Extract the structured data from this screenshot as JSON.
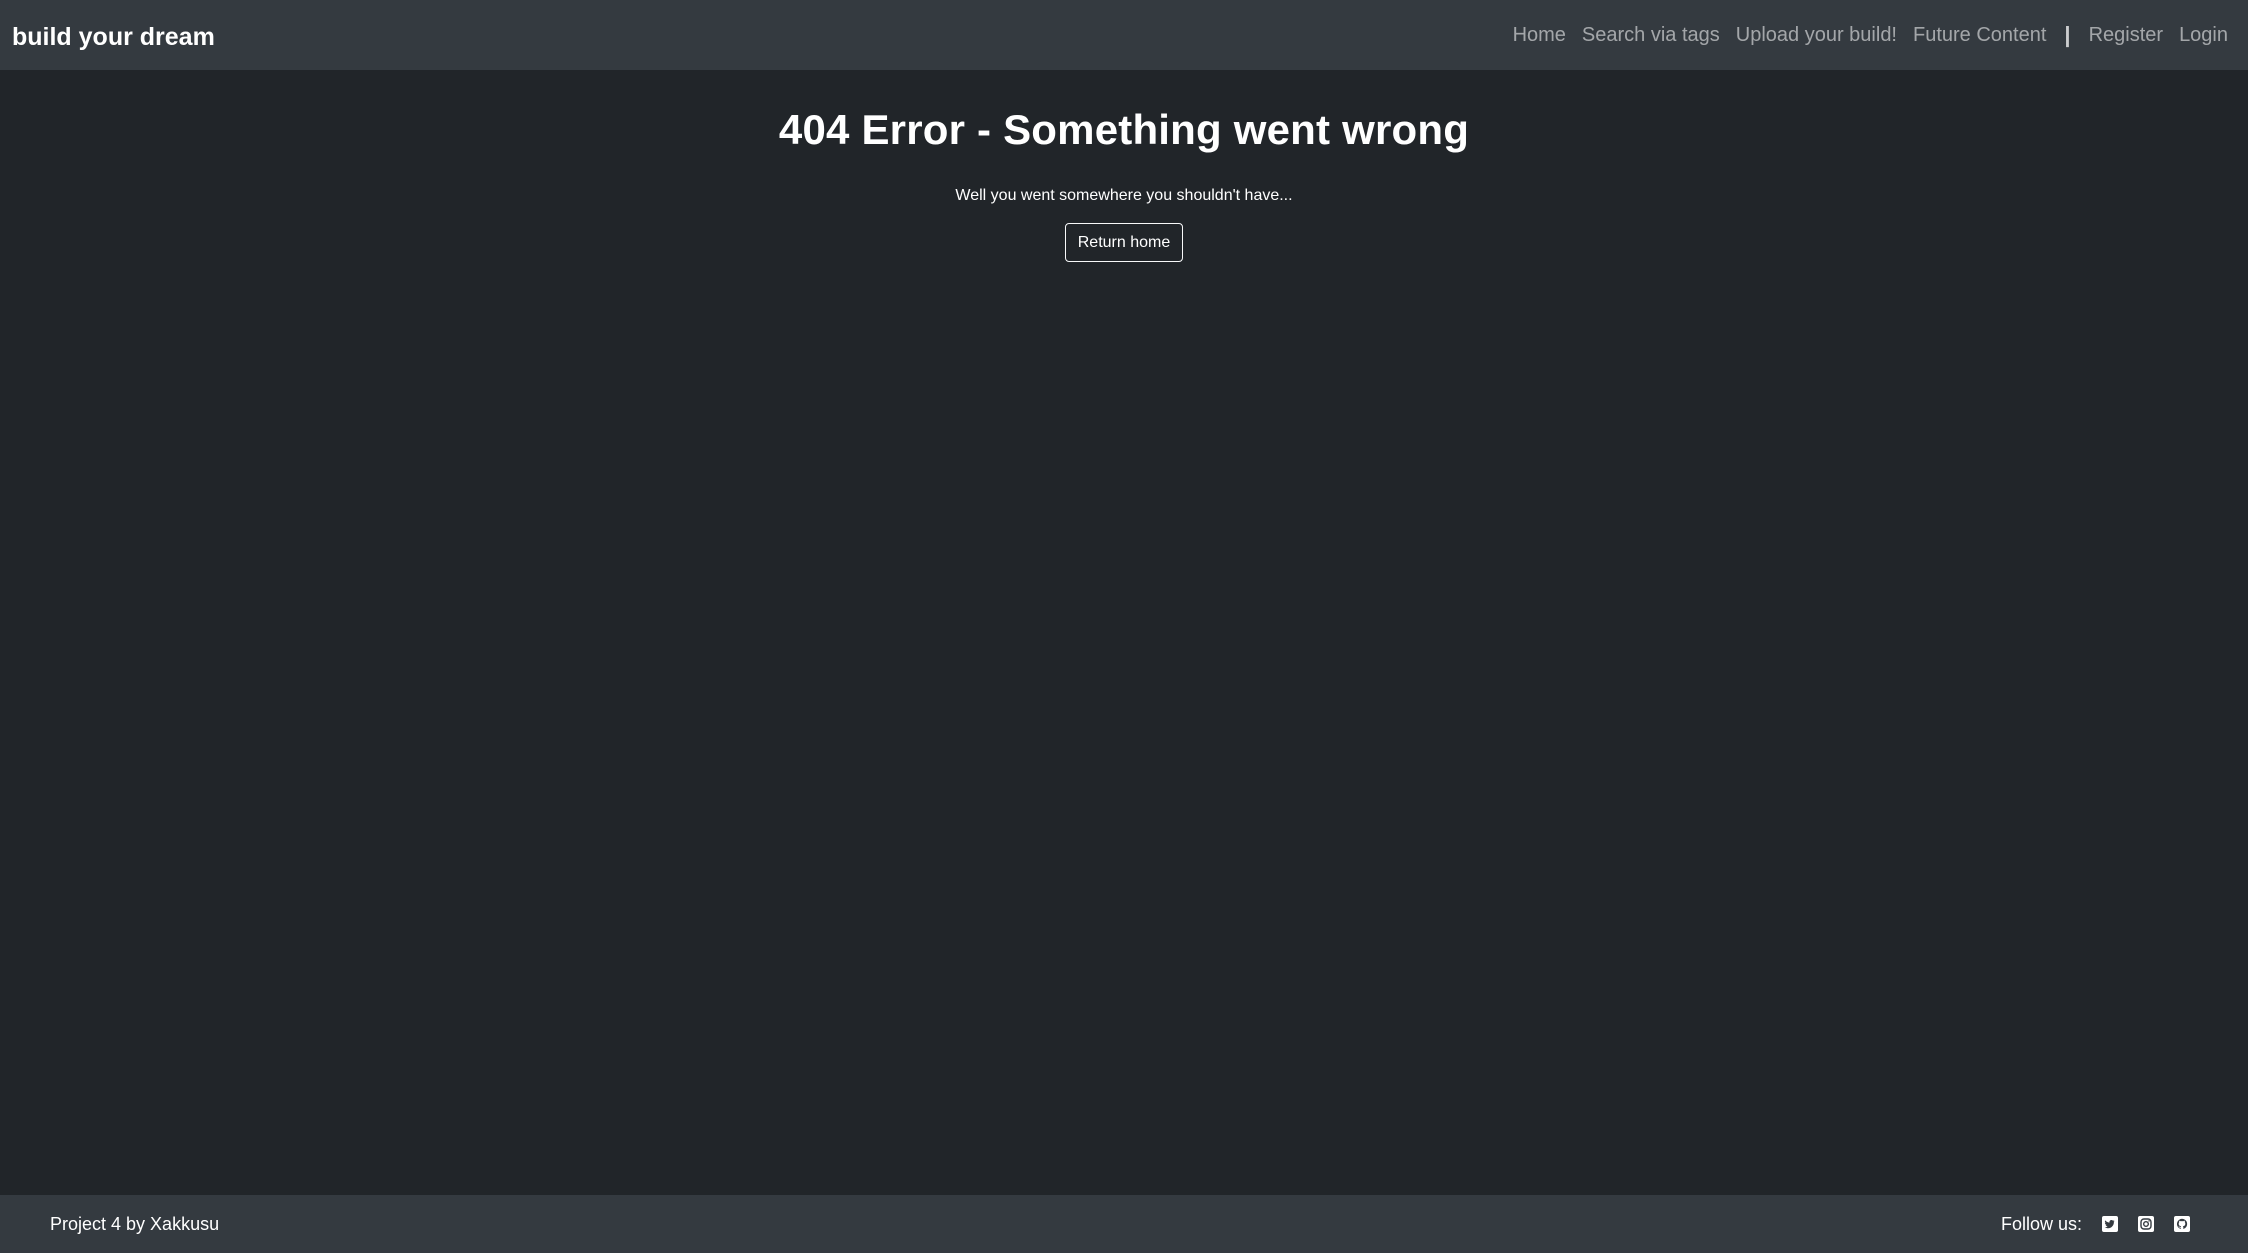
{
  "navbar": {
    "brand": "build your dream",
    "links": [
      {
        "label": "Home"
      },
      {
        "label": "Search via tags"
      },
      {
        "label": "Upload your build!"
      },
      {
        "label": "Future Content"
      }
    ],
    "separator": "|",
    "auth_links": [
      {
        "label": "Register"
      },
      {
        "label": "Login"
      }
    ]
  },
  "main": {
    "title": "404 Error - Something went wrong",
    "subtitle": "Well you went somewhere you shouldn't have...",
    "return_button": "Return home"
  },
  "footer": {
    "credit": "Project 4 by Xakkusu",
    "follow_label": "Follow us:",
    "social_icons": [
      "twitter-icon",
      "instagram-icon",
      "github-icon"
    ]
  },
  "colors": {
    "background": "#212529",
    "navbar": "#343a40",
    "text": "#ffffff",
    "nav_link": "#8c9196"
  }
}
